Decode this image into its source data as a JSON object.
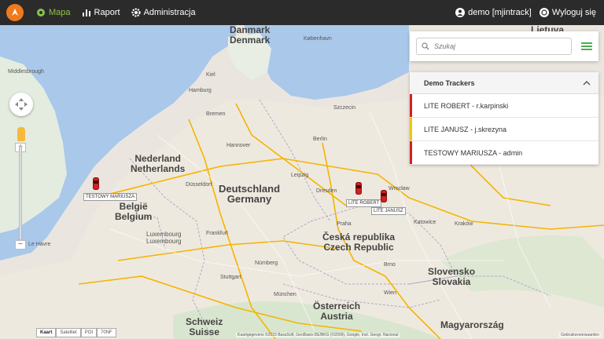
{
  "nav": {
    "map_label": "Mapa",
    "report_label": "Raport",
    "admin_label": "Administracja",
    "user_label": "demo [mjintrack]",
    "logout_label": "Wyloguj się"
  },
  "search": {
    "placeholder": "Szukaj"
  },
  "tracker_group": {
    "title": "Demo Trackers",
    "items": [
      {
        "label": "LITE ROBERT - r.karpinski",
        "color": "#d32020"
      },
      {
        "label": "LITE JANUSZ - j.skrezyna",
        "color": "#f0c419"
      },
      {
        "label": "TESTOWY MARIUSZA - admin",
        "color": "#d32020"
      }
    ]
  },
  "markers": {
    "m1": "TESTOWY MARIUSZA",
    "m2": "LITE ROBERT",
    "m3": "LITE JANUSZ"
  },
  "map_labels": {
    "danmark1": "Danmark",
    "danmark2": "Denmark",
    "nederland1": "Nederland",
    "nederland2": "Netherlands",
    "deutschland1": "Deutschland",
    "deutschland2": "Germany",
    "belgie1": "België",
    "belgie2": "Belgium",
    "luxembourg1": "Luxembourg",
    "luxembourg2": "Luxembourg",
    "czech1": "Česká republika",
    "czech2": "Czech Republic",
    "slovensko1": "Slovensko",
    "slovensko2": "Slovakia",
    "osterreich1": "Österreich",
    "osterreich2": "Austria",
    "schweiz1": "Schweiz",
    "schweiz2": "Suisse",
    "magyar": "Magyarország",
    "lietuva": "Lietuva",
    "hamburg": "Hamburg",
    "bremen": "Bremen",
    "hannover": "Hannover",
    "berlin": "Berlin",
    "dresden": "Dresden",
    "praha": "Praha",
    "brno": "Brno",
    "wroclaw": "Wrocław",
    "katowice": "Katowice",
    "krakow": "Kraków",
    "szczecin": "Szczecin",
    "dusseldorf": "Düsseldorf",
    "frankfurt": "Frankfurt",
    "munchen": "München",
    "wien": "Wien",
    "nurnberg": "Nürnberg",
    "stuttgart": "Stuttgart",
    "kobenhavn": "København",
    "kiel": "Kiel",
    "leipzig": "Leipzig",
    "middlesbrough": "Middlesbrough",
    "lehavre": "Le Havre"
  },
  "map_controls": {
    "type_map": "Kaart",
    "type_sat": "Satelliet",
    "poi": "POI",
    "zone": "70NF",
    "copyright": "Kaartgegevens ©2015 BasaSoft, GeoBasis-DE/BKG (©2009), Google, Inst. Geogr. Nacional",
    "scale": "Gebruiksvoorwaarden"
  },
  "colors": {
    "accent": "#8bc34a",
    "navbar": "#2b2b2b",
    "logo": "#f07a1c",
    "marker": "#d32020"
  }
}
